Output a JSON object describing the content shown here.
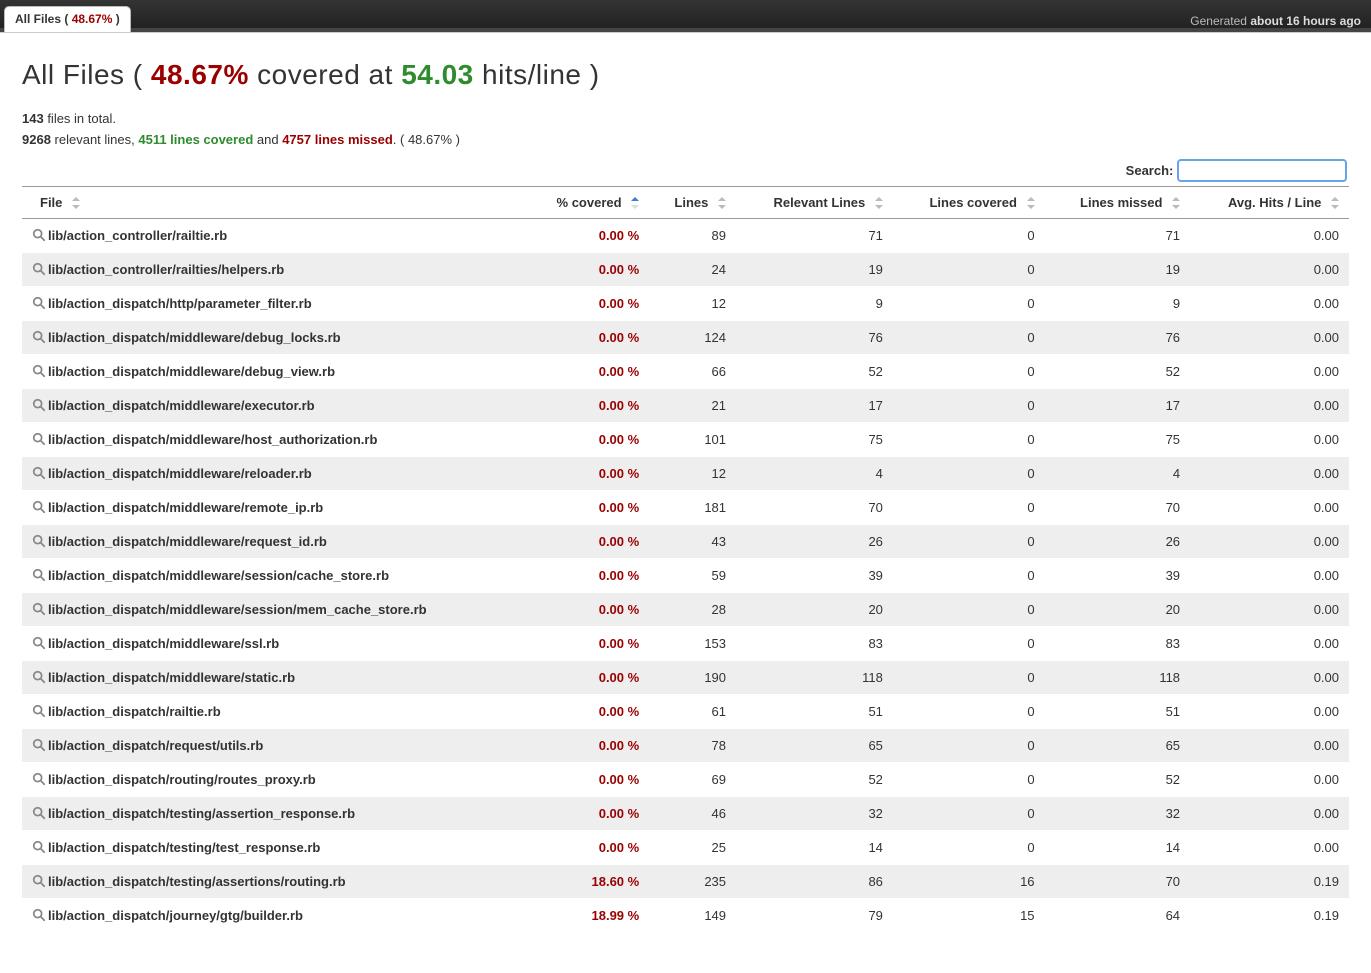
{
  "header": {
    "tab_label_prefix": "All Files ( ",
    "tab_pct": "48.67%",
    "tab_label_suffix": " )",
    "generated_prefix": "Generated ",
    "generated_time": "about 16 hours ago"
  },
  "title": {
    "prefix": "All Files ( ",
    "pct": "48.67%",
    "mid": " covered at ",
    "hits": "54.03",
    "suffix": " hits/line )"
  },
  "summary": {
    "files_total_n": "143",
    "files_total_label": " files in total.",
    "relevant_n": "9268",
    "relevant_label": " relevant lines, ",
    "covered_n": "4511 lines covered",
    "and": " and ",
    "missed_n": "4757 lines missed",
    "tail": ". ( 48.67% )"
  },
  "search": {
    "label": "Search:",
    "placeholder": ""
  },
  "columns": {
    "file": "File",
    "pct": "% covered",
    "lines": "Lines",
    "relevant": "Relevant Lines",
    "covered": "Lines covered",
    "missed": "Lines missed",
    "avg": "Avg. Hits / Line"
  },
  "rows": [
    {
      "file": "lib/action_controller/railtie.rb",
      "pct": "0.00 %",
      "lines": "89",
      "relevant": "71",
      "covered": "0",
      "missed": "71",
      "avg": "0.00"
    },
    {
      "file": "lib/action_controller/railties/helpers.rb",
      "pct": "0.00 %",
      "lines": "24",
      "relevant": "19",
      "covered": "0",
      "missed": "19",
      "avg": "0.00"
    },
    {
      "file": "lib/action_dispatch/http/parameter_filter.rb",
      "pct": "0.00 %",
      "lines": "12",
      "relevant": "9",
      "covered": "0",
      "missed": "9",
      "avg": "0.00"
    },
    {
      "file": "lib/action_dispatch/middleware/debug_locks.rb",
      "pct": "0.00 %",
      "lines": "124",
      "relevant": "76",
      "covered": "0",
      "missed": "76",
      "avg": "0.00"
    },
    {
      "file": "lib/action_dispatch/middleware/debug_view.rb",
      "pct": "0.00 %",
      "lines": "66",
      "relevant": "52",
      "covered": "0",
      "missed": "52",
      "avg": "0.00"
    },
    {
      "file": "lib/action_dispatch/middleware/executor.rb",
      "pct": "0.00 %",
      "lines": "21",
      "relevant": "17",
      "covered": "0",
      "missed": "17",
      "avg": "0.00"
    },
    {
      "file": "lib/action_dispatch/middleware/host_authorization.rb",
      "pct": "0.00 %",
      "lines": "101",
      "relevant": "75",
      "covered": "0",
      "missed": "75",
      "avg": "0.00"
    },
    {
      "file": "lib/action_dispatch/middleware/reloader.rb",
      "pct": "0.00 %",
      "lines": "12",
      "relevant": "4",
      "covered": "0",
      "missed": "4",
      "avg": "0.00"
    },
    {
      "file": "lib/action_dispatch/middleware/remote_ip.rb",
      "pct": "0.00 %",
      "lines": "181",
      "relevant": "70",
      "covered": "0",
      "missed": "70",
      "avg": "0.00"
    },
    {
      "file": "lib/action_dispatch/middleware/request_id.rb",
      "pct": "0.00 %",
      "lines": "43",
      "relevant": "26",
      "covered": "0",
      "missed": "26",
      "avg": "0.00"
    },
    {
      "file": "lib/action_dispatch/middleware/session/cache_store.rb",
      "pct": "0.00 %",
      "lines": "59",
      "relevant": "39",
      "covered": "0",
      "missed": "39",
      "avg": "0.00"
    },
    {
      "file": "lib/action_dispatch/middleware/session/mem_cache_store.rb",
      "pct": "0.00 %",
      "lines": "28",
      "relevant": "20",
      "covered": "0",
      "missed": "20",
      "avg": "0.00"
    },
    {
      "file": "lib/action_dispatch/middleware/ssl.rb",
      "pct": "0.00 %",
      "lines": "153",
      "relevant": "83",
      "covered": "0",
      "missed": "83",
      "avg": "0.00"
    },
    {
      "file": "lib/action_dispatch/middleware/static.rb",
      "pct": "0.00 %",
      "lines": "190",
      "relevant": "118",
      "covered": "0",
      "missed": "118",
      "avg": "0.00"
    },
    {
      "file": "lib/action_dispatch/railtie.rb",
      "pct": "0.00 %",
      "lines": "61",
      "relevant": "51",
      "covered": "0",
      "missed": "51",
      "avg": "0.00"
    },
    {
      "file": "lib/action_dispatch/request/utils.rb",
      "pct": "0.00 %",
      "lines": "78",
      "relevant": "65",
      "covered": "0",
      "missed": "65",
      "avg": "0.00"
    },
    {
      "file": "lib/action_dispatch/routing/routes_proxy.rb",
      "pct": "0.00 %",
      "lines": "69",
      "relevant": "52",
      "covered": "0",
      "missed": "52",
      "avg": "0.00"
    },
    {
      "file": "lib/action_dispatch/testing/assertion_response.rb",
      "pct": "0.00 %",
      "lines": "46",
      "relevant": "32",
      "covered": "0",
      "missed": "32",
      "avg": "0.00"
    },
    {
      "file": "lib/action_dispatch/testing/test_response.rb",
      "pct": "0.00 %",
      "lines": "25",
      "relevant": "14",
      "covered": "0",
      "missed": "14",
      "avg": "0.00"
    },
    {
      "file": "lib/action_dispatch/testing/assertions/routing.rb",
      "pct": "18.60 %",
      "lines": "235",
      "relevant": "86",
      "covered": "16",
      "missed": "70",
      "avg": "0.19"
    },
    {
      "file": "lib/action_dispatch/journey/gtg/builder.rb",
      "pct": "18.99 %",
      "lines": "149",
      "relevant": "79",
      "covered": "15",
      "missed": "64",
      "avg": "0.19"
    }
  ]
}
